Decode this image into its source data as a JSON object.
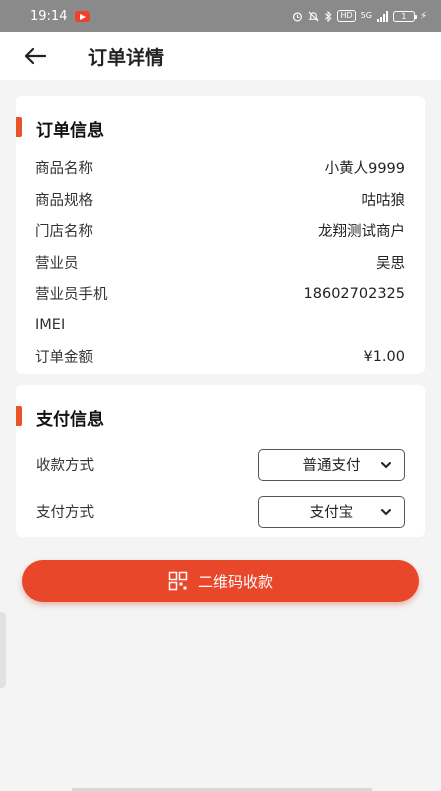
{
  "status": {
    "time": "19:14",
    "hd": "HD",
    "signal": "5G",
    "battery": "1"
  },
  "nav": {
    "title": "订单详情"
  },
  "order": {
    "title": "订单信息",
    "rows": [
      {
        "label": "商品名称",
        "value": "小黄人9999"
      },
      {
        "label": "商品规格",
        "value": "咕咕狼"
      },
      {
        "label": "门店名称",
        "value": "龙翔测试商户"
      },
      {
        "label": "营业员",
        "value": "吴思"
      },
      {
        "label": "营业员手机",
        "value": "18602702325"
      },
      {
        "label": "IMEI",
        "value": ""
      },
      {
        "label": "订单金额",
        "value": "¥1.00"
      }
    ]
  },
  "payment": {
    "title": "支付信息",
    "collect_label": "收款方式",
    "collect_value": "普通支付",
    "method_label": "支付方式",
    "method_value": "支付宝"
  },
  "qr_button": {
    "label": "二维码收款",
    "icon": "qrcode-icon"
  },
  "colors": {
    "accent": "#e8472a",
    "status_bar": "#8a8a8a"
  }
}
